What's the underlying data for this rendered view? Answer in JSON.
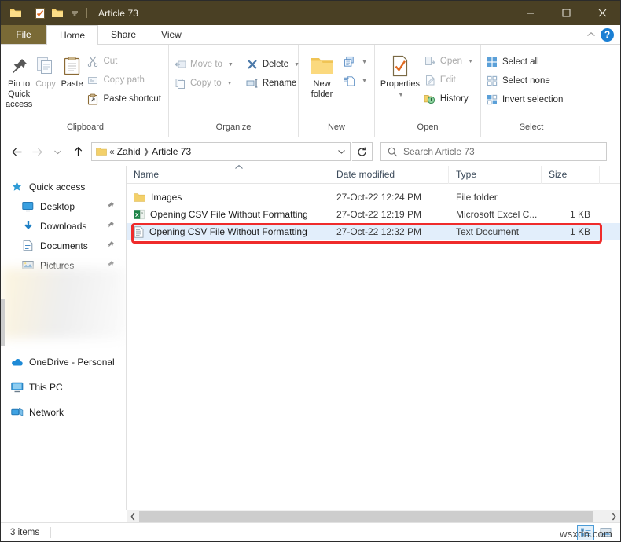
{
  "window": {
    "title": "Article 73",
    "quick_access_toolbar": [
      {
        "icon": "folder-icon",
        "name": "qat-folder"
      },
      {
        "icon": "properties-icon",
        "name": "qat-properties"
      },
      {
        "icon": "new-folder-icon",
        "name": "qat-new-folder"
      },
      {
        "icon": "chevron-down-icon",
        "name": "qat-customize"
      }
    ],
    "controls": {
      "minimize": "–",
      "maximize": "□",
      "close": "✕"
    },
    "titlebar_color": "#4a4024"
  },
  "tabs": {
    "file": "File",
    "items": [
      {
        "label": "Home",
        "active": true
      },
      {
        "label": "Share",
        "active": false
      },
      {
        "label": "View",
        "active": false
      }
    ],
    "collapse_icon": "chevron-up-icon",
    "help_icon": "help-icon",
    "help_label": "?"
  },
  "ribbon": {
    "groups": [
      {
        "label": "Clipboard",
        "big_buttons": [
          {
            "label": "Pin to Quick\naccess",
            "line1": "Pin to Quick",
            "line2": "access",
            "icon": "pin-icon",
            "dim": false
          },
          {
            "label": "Copy",
            "line1": "Copy",
            "line2": "",
            "icon": "copy-icon",
            "dim": true
          },
          {
            "label": "Paste",
            "line1": "Paste",
            "line2": "",
            "icon": "paste-icon",
            "dim": false
          }
        ],
        "small_buttons": [
          {
            "label": "Cut",
            "icon": "scissors-icon",
            "dim": true,
            "caret": false
          },
          {
            "label": "Copy path",
            "icon": "copy-path-icon",
            "dim": true,
            "caret": false
          },
          {
            "label": "Paste shortcut",
            "icon": "paste-shortcut-icon",
            "dim": false,
            "caret": false
          }
        ]
      },
      {
        "label": "Organize",
        "small_buttons_a": [
          {
            "label": "Move to",
            "icon": "move-to-icon",
            "dim": true,
            "caret": true
          },
          {
            "label": "Copy to",
            "icon": "copy-to-icon",
            "dim": true,
            "caret": true
          }
        ],
        "small_buttons_b": [
          {
            "label": "Delete",
            "icon": "delete-icon",
            "dim": false,
            "caret": true
          },
          {
            "label": "Rename",
            "icon": "rename-icon",
            "dim": false,
            "caret": false
          }
        ]
      },
      {
        "label": "New",
        "big_buttons": [
          {
            "label": "New folder",
            "line1": "New",
            "line2": "folder",
            "icon": "new-folder-icon",
            "dim": false
          }
        ],
        "small_buttons": [
          {
            "label": "",
            "icon": "new-item-icon",
            "dim": false,
            "caret": true
          },
          {
            "label": "",
            "icon": "easy-access-icon",
            "dim": false,
            "caret": true
          }
        ]
      },
      {
        "label": "Open",
        "big_buttons": [
          {
            "label": "Properties",
            "line1": "Properties",
            "line2": "",
            "icon": "properties-icon",
            "dim": false,
            "dropdown": true
          }
        ],
        "small_buttons": [
          {
            "label": "Open",
            "icon": "open-icon",
            "dim": true,
            "caret": true
          },
          {
            "label": "Edit",
            "icon": "edit-icon",
            "dim": true,
            "caret": false
          },
          {
            "label": "History",
            "icon": "history-icon",
            "dim": false,
            "caret": false
          }
        ]
      },
      {
        "label": "Select",
        "small_buttons": [
          {
            "label": "Select all",
            "icon": "select-all-icon",
            "dim": false,
            "caret": false
          },
          {
            "label": "Select none",
            "icon": "select-none-icon",
            "dim": false,
            "caret": false
          },
          {
            "label": "Invert selection",
            "icon": "invert-selection-icon",
            "dim": false,
            "caret": false
          }
        ]
      }
    ]
  },
  "address_bar": {
    "back_icon": "arrow-left-icon",
    "forward_icon": "arrow-right-icon",
    "recent_icon": "chevron-down-icon",
    "up_icon": "arrow-up-icon",
    "folder_icon": "folder-icon",
    "overflow": "«",
    "crumbs": [
      "Zahid",
      "Article 73"
    ],
    "dropdown_icon": "chevron-down-icon",
    "refresh_icon": "refresh-icon"
  },
  "search": {
    "icon": "search-icon",
    "placeholder": "Search Article 73",
    "value": ""
  },
  "nav_pane": {
    "sections": [
      {
        "root": {
          "label": "Quick access",
          "icon": "quick-access-star-icon"
        },
        "items": [
          {
            "label": "Desktop",
            "icon": "desktop-icon",
            "pinned": true
          },
          {
            "label": "Downloads",
            "icon": "downloads-icon",
            "pinned": true
          },
          {
            "label": "Documents",
            "icon": "documents-icon",
            "pinned": true
          },
          {
            "label": "Pictures",
            "icon": "pictures-icon",
            "pinned": true
          }
        ]
      }
    ],
    "bottom_items": [
      {
        "label": "OneDrive - Personal",
        "icon": "onedrive-cloud-icon"
      },
      {
        "label": "This PC",
        "icon": "this-pc-icon"
      },
      {
        "label": "Network",
        "icon": "network-icon"
      }
    ],
    "blurred_region": true
  },
  "file_list": {
    "columns": [
      {
        "key": "name",
        "label": "Name",
        "sorted": "asc"
      },
      {
        "key": "date",
        "label": "Date modified"
      },
      {
        "key": "type",
        "label": "Type"
      },
      {
        "key": "size",
        "label": "Size"
      }
    ],
    "rows": [
      {
        "name": "Images",
        "date": "27-Oct-22 12:24 PM",
        "type": "File folder",
        "size": "",
        "icon": "folder-icon",
        "highlighted": false
      },
      {
        "name": "Opening CSV File Without Formatting",
        "date": "27-Oct-22 12:19 PM",
        "type": "Microsoft Excel C...",
        "size": "1 KB",
        "icon": "excel-csv-icon",
        "highlighted": false
      },
      {
        "name": "Opening CSV File Without Formatting",
        "date": "27-Oct-22 12:32 PM",
        "type": "Text Document",
        "size": "1 KB",
        "icon": "text-document-icon",
        "highlighted": true
      }
    ],
    "annotation": {
      "shape": "rectangle",
      "color": "#ef2b2b",
      "target_row_index": 2
    }
  },
  "status_bar": {
    "item_count": "3 items",
    "view_buttons": [
      {
        "name": "details-view-button",
        "icon": "details-view-icon",
        "active": true
      },
      {
        "name": "large-icons-view-button",
        "icon": "large-icons-view-icon",
        "active": false
      }
    ]
  },
  "watermark": {
    "text": "wsxdn.com"
  }
}
